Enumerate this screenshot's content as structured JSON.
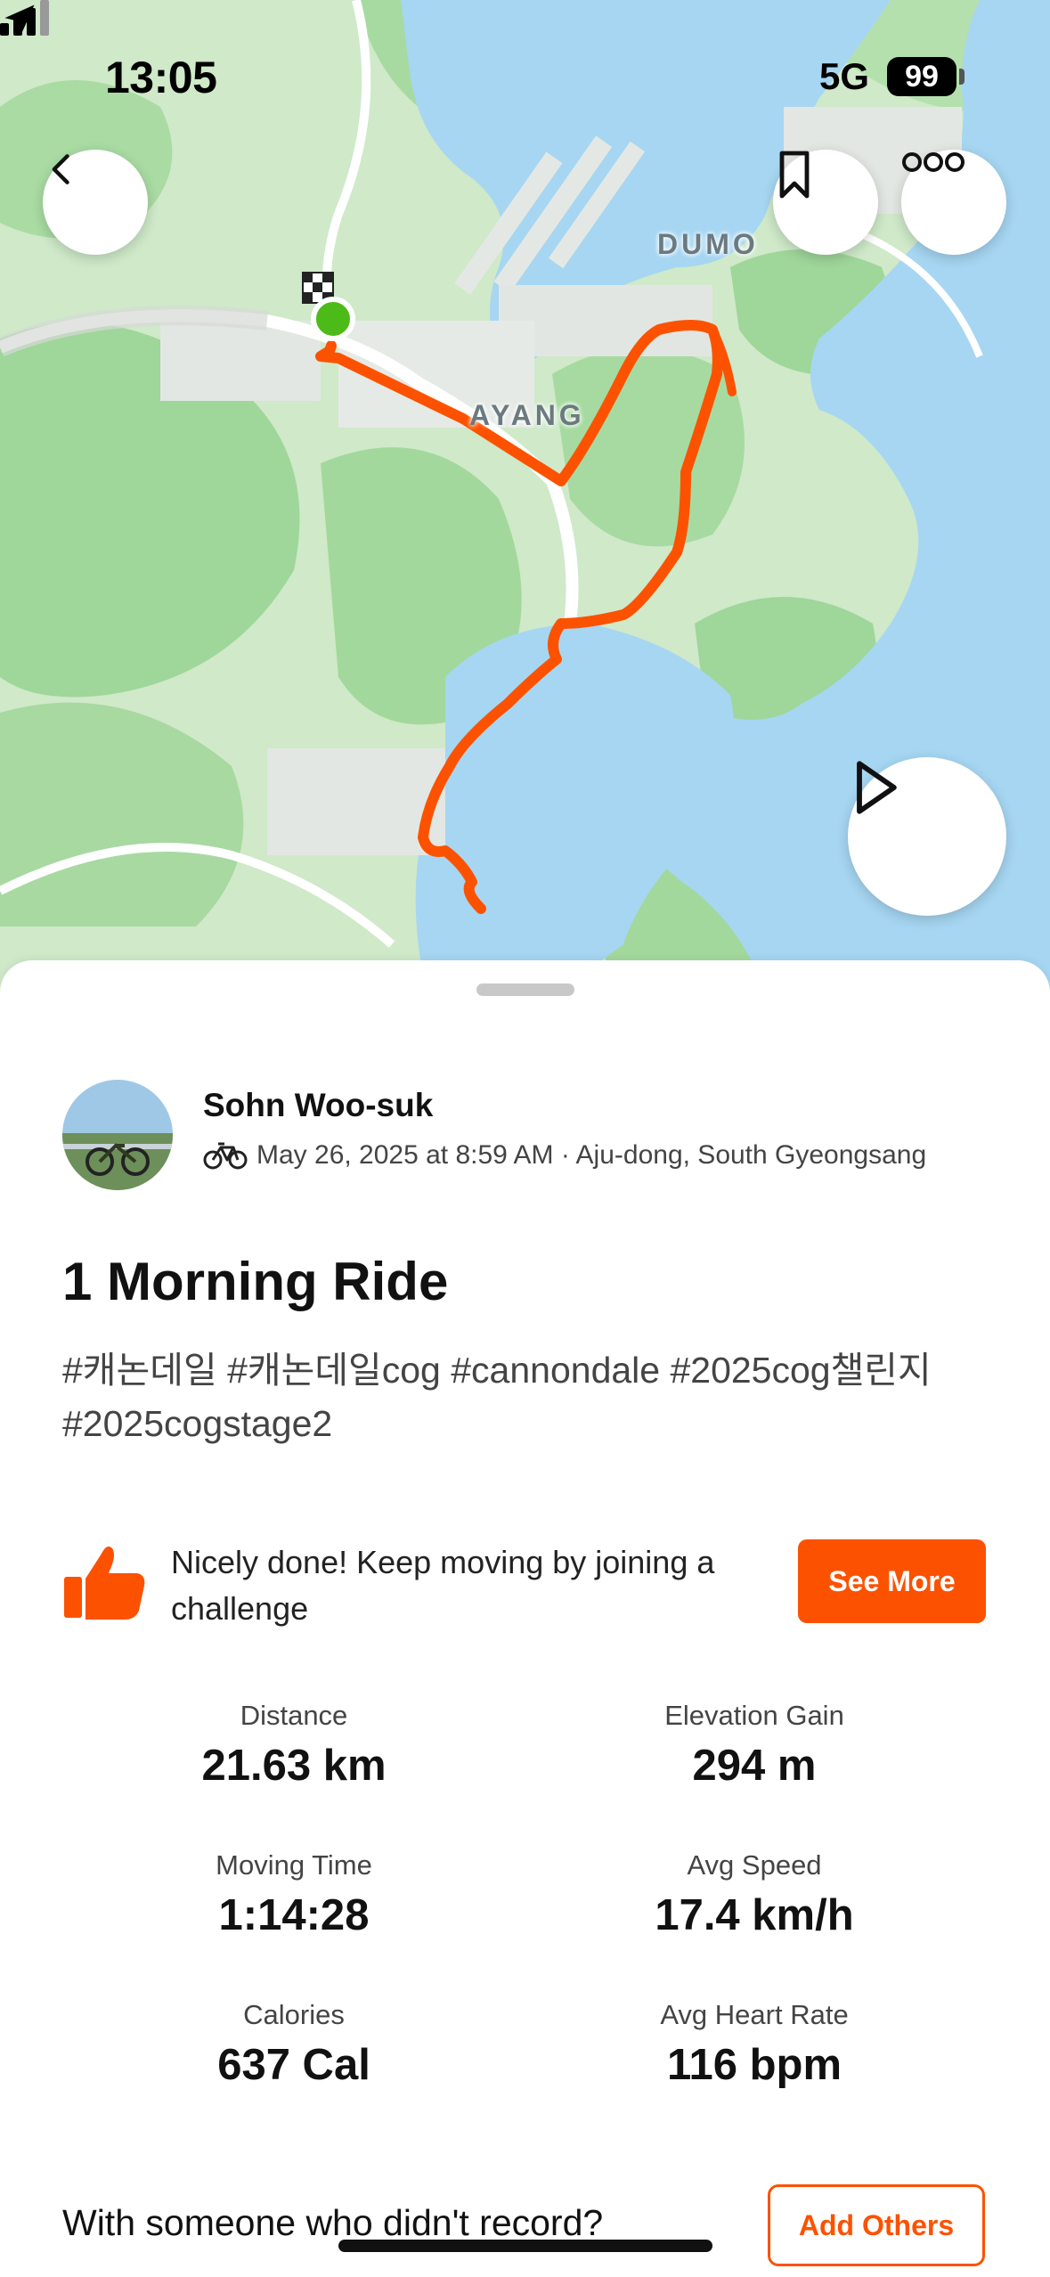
{
  "status_bar": {
    "time": "13:05",
    "network": "5G",
    "battery": "99"
  },
  "map": {
    "labels": [
      "AYANG",
      "DUMO"
    ],
    "route_color": "#fc5200",
    "start_marker_color": "#4cbb17",
    "buttons": {
      "back": "back-icon",
      "bookmark": "bookmark-icon",
      "more": "more-icon",
      "play": "play-icon"
    }
  },
  "activity": {
    "athlete_name": "Sohn Woo-suk",
    "sport_icon": "bike-icon",
    "meta": "May 26, 2025 at 8:59 AM · Aju-dong, South Gyeongsang",
    "title": "1 Morning Ride",
    "description": "#캐논데일 #캐논데일cog #cannondale #2025cog챌린지 #2025cogstage2"
  },
  "promo": {
    "icon": "thumbs-up-icon",
    "text": "Nicely done! Keep moving by joining a challenge",
    "button_label": "See More"
  },
  "stats": [
    {
      "label": "Distance",
      "value": "21.63 km"
    },
    {
      "label": "Elevation Gain",
      "value": "294 m"
    },
    {
      "label": "Moving Time",
      "value": "1:14:28"
    },
    {
      "label": "Avg Speed",
      "value": "17.4 km/h"
    },
    {
      "label": "Calories",
      "value": "637 Cal"
    },
    {
      "label": "Avg Heart Rate",
      "value": "116 bpm"
    }
  ],
  "with_others": {
    "prompt": "With someone who didn't record?",
    "button_label": "Add Others"
  },
  "colors": {
    "accent": "#fc5200",
    "water": "#a6d6f2",
    "land": "#d6ecd2",
    "forest": "#9fd69a"
  }
}
